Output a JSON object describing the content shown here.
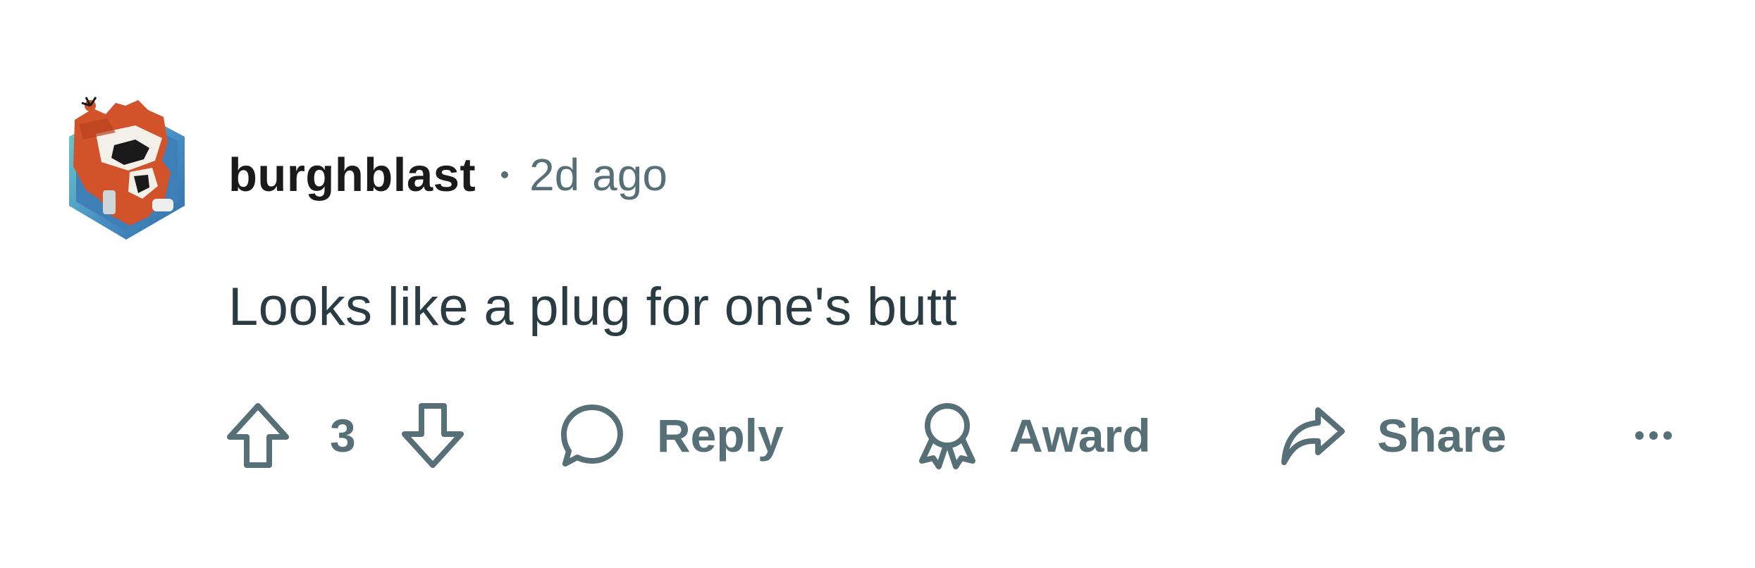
{
  "comment": {
    "author": "burghblast",
    "timestamp": "2d ago",
    "body": "Looks like a plug for one's butt",
    "avatar_icon": "robot-avatar-icon"
  },
  "actions": {
    "vote_count": "3",
    "reply_label": "Reply",
    "award_label": "Award",
    "share_label": "Share"
  },
  "colors": {
    "text_primary": "#1a1a1b",
    "text_body": "#2a3c42",
    "text_meta": "#576f76",
    "background": "#ffffff",
    "avatar_hex": "#4a90c4",
    "avatar_accent": "#d2532a"
  }
}
